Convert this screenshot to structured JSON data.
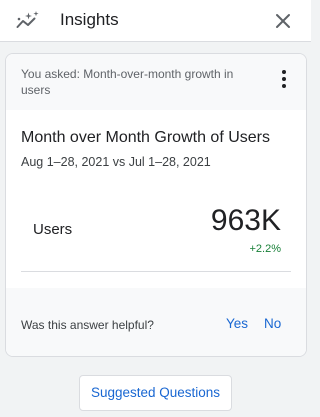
{
  "header": {
    "title": "Insights",
    "icon": "insights-sparkle-icon",
    "close_icon": "close-icon"
  },
  "card": {
    "question": "You asked: Month-over-month growth in users",
    "more_icon": "more-vert-icon",
    "title": "Month over Month Growth of Users",
    "date_range": "Aug 1–28, 2021 vs Jul 1–28, 2021",
    "metric": {
      "label": "Users",
      "value": "963K",
      "change": "+2.2%"
    },
    "feedback": {
      "question": "Was this answer helpful?",
      "yes_label": "Yes",
      "no_label": "No"
    }
  },
  "suggested_button_label": "Suggested Questions",
  "colors": {
    "accent": "#1967d2",
    "positive": "#188038",
    "background": "#f1f3f4"
  }
}
